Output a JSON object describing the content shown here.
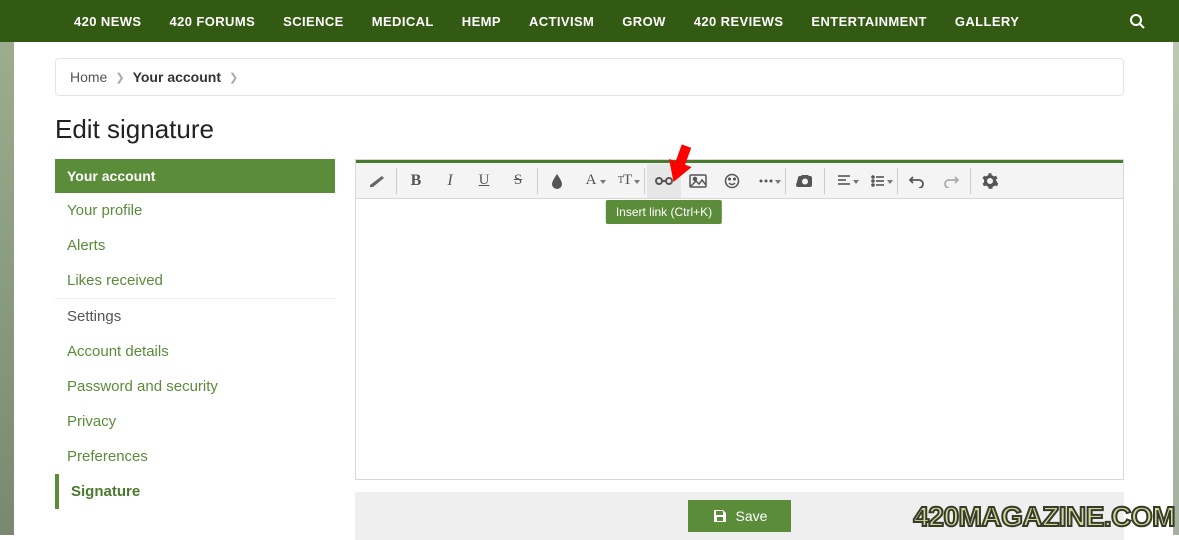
{
  "nav": {
    "items": [
      "420 NEWS",
      "420 FORUMS",
      "SCIENCE",
      "MEDICAL",
      "HEMP",
      "ACTIVISM",
      "GROW",
      "420 REVIEWS",
      "ENTERTAINMENT",
      "GALLERY"
    ]
  },
  "breadcrumb": {
    "home": "Home",
    "current": "Your account"
  },
  "page_title": "Edit signature",
  "sidebar": {
    "header": "Your account",
    "links1": [
      "Your profile",
      "Alerts",
      "Likes received"
    ],
    "group_label": "Settings",
    "links2": [
      "Account details",
      "Password and security",
      "Privacy",
      "Preferences",
      "Signature"
    ],
    "active": "Signature"
  },
  "editor": {
    "tooltip": "Insert link (Ctrl+K)",
    "save_label": "Save"
  },
  "watermark": "420MAGAZINE.COM"
}
